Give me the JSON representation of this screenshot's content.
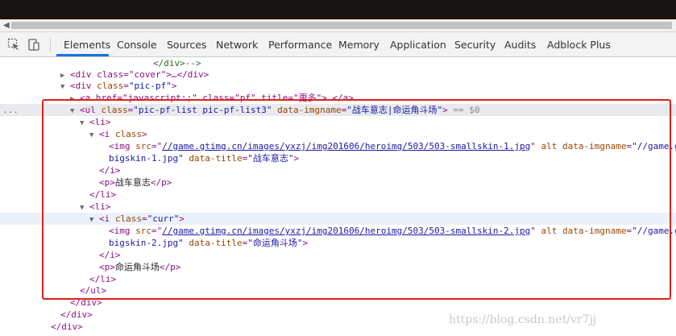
{
  "toolbar": {
    "tabs": [
      "Elements",
      "Console",
      "Sources",
      "Network",
      "Performance",
      "Memory",
      "Application",
      "Security",
      "Audits",
      "Adblock Plus"
    ],
    "active_tab": "Elements"
  },
  "code": {
    "l0": "</div>-->",
    "l1_open": "<div class=\"cover\">…</div>",
    "l2_tag": "div",
    "l2_attr": "class",
    "l2_val": "\"pic-pf\"",
    "l3_text": "<a href=\"javascript:;\" class=\"pf\" title=\"更多\">…</a>",
    "l4_tag": "ul",
    "l4_attr1": "class",
    "l4_val1": "\"pic-pf-list pic-pf-list3\"",
    "l4_attr2": "data-imgname",
    "l4_val2": "\"战车意志|命运角斗场\"",
    "l4_eq": "== $0",
    "li": "li",
    "i_tag": "i",
    "i_class_attr": "class",
    "img_src_attr": "src",
    "img1_src": "//game.gtimg.cn/images/yxzj/img201606/heroimg/503/503-smallskin-1.jpg",
    "img_alt": "alt",
    "img_dataimg": "data-imgname",
    "img_dataimg_val": "\"//game.g",
    "img1_cont": "bigskin-1.jpg\"",
    "data_title": "data-title",
    "img1_title": "\"战车意志\"",
    "p_tag": "p",
    "p1_text": "战车意志",
    "i2_class_val": "\"curr\"",
    "img2_src": "//game.gtimg.cn/images/yxzj/img201606/heroimg/503/503-smallskin-2.jpg",
    "img2_cont": "bigskin-2.jpg\"",
    "img2_title": "\"命运角斗场\"",
    "p2_text": "命运角斗场",
    "ul_close": "</ul>",
    "div_close": "</div>",
    "ellipsis": "..."
  },
  "watermark": "https://blog.csdn.net/vr7jj",
  "colors": {
    "tag": "#881280",
    "attr": "#994500",
    "value": "#1a1aa6",
    "highlight_box": "#e0201a"
  }
}
